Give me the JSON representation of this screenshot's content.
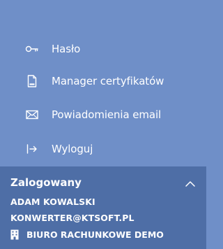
{
  "menu": {
    "items": [
      {
        "label": "Hasło",
        "icon": "key-icon"
      },
      {
        "label": "Manager certyfikatów",
        "icon": "certificate-icon"
      },
      {
        "label": "Powiadomienia email",
        "icon": "envelope-icon"
      },
      {
        "label": "Wyloguj",
        "icon": "logout-icon"
      }
    ]
  },
  "login": {
    "header": "Zalogowany",
    "collapse_icon": "chevron-up-icon",
    "user_name": "ADAM KOWALSKI",
    "user_email": "KONWERTER@KTSOFT.PL",
    "company_icon": "building-icon",
    "company_name": "BIURO RACHUNKOWE DEMO"
  },
  "colors": {
    "menu_background": "#6f8fc8",
    "panel_background": "#4e6ea6",
    "text": "#ffffff"
  }
}
